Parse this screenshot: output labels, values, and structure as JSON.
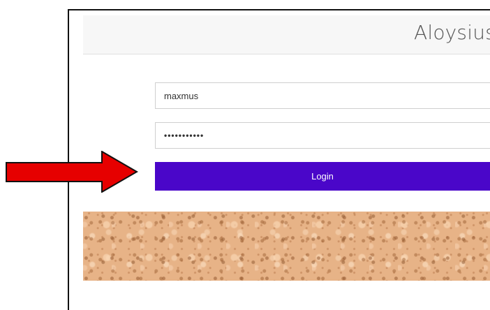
{
  "header": {
    "app_title": "Aloysius"
  },
  "login_form": {
    "username_value": "maxmus",
    "password_value": "•••••••••••",
    "login_label": "Login"
  },
  "colors": {
    "login_button": "#4a06c9",
    "annotation_arrow": "#e60000",
    "cork_background": "#e7b387"
  },
  "icons": {
    "annotation": "red-arrow-icon"
  }
}
